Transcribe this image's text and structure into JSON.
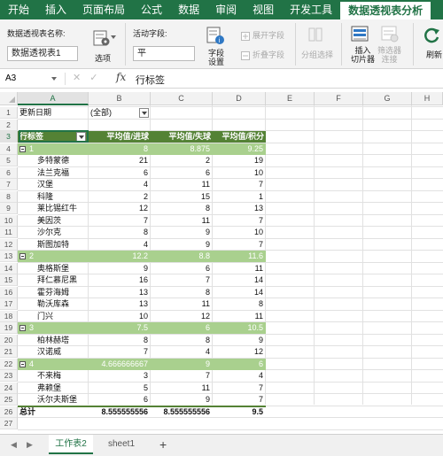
{
  "ribbon_tabs": [
    "开始",
    "插入",
    "页面布局",
    "公式",
    "数据",
    "审阅",
    "视图",
    "开发工具",
    "数据透视表分析"
  ],
  "ribbon": {
    "pt_name_label": "数据透视表名称:",
    "pt_name_value": "数据透视表1",
    "options_label": "选项",
    "active_field_label": "活动字段:",
    "active_field_value": "平",
    "field_settings_label_1": "字段",
    "field_settings_label_2": "设置",
    "expand_field": "展开字段",
    "collapse_field": "折叠字段",
    "group_selection": "分组选择",
    "insert_slicer_1": "插入",
    "insert_slicer_2": "切片器",
    "filter_conn_1": "筛选器",
    "filter_conn_2": "连接",
    "refresh": "刷新"
  },
  "formula_bar": {
    "name_box": "A3",
    "fx_label": "fx",
    "content": "行标签"
  },
  "columns": [
    "A",
    "B",
    "C",
    "D",
    "E",
    "F",
    "G",
    "H"
  ],
  "rows": [
    {
      "n": "1",
      "a": "更新日期",
      "b": "(全部)",
      "c": "",
      "d": "",
      "type": "filter"
    },
    {
      "n": "2",
      "a": "",
      "b": "",
      "c": "",
      "d": "",
      "type": "blank"
    },
    {
      "n": "3",
      "a": "行标签",
      "b": "平均值/进球",
      "c": "平均值/失球",
      "d": "平均值/积分",
      "type": "header"
    },
    {
      "n": "4",
      "a": "1",
      "b": "8",
      "c": "8.875",
      "d": "9.25",
      "type": "group"
    },
    {
      "n": "5",
      "a": "多特蒙德",
      "b": "21",
      "c": "2",
      "d": "19",
      "type": "item"
    },
    {
      "n": "6",
      "a": "法兰克福",
      "b": "6",
      "c": "6",
      "d": "10",
      "type": "item"
    },
    {
      "n": "7",
      "a": "汉堡",
      "b": "4",
      "c": "11",
      "d": "7",
      "type": "item"
    },
    {
      "n": "8",
      "a": "科隆",
      "b": "2",
      "c": "15",
      "d": "1",
      "type": "item"
    },
    {
      "n": "9",
      "a": "莱比锡红牛",
      "b": "12",
      "c": "8",
      "d": "13",
      "type": "item"
    },
    {
      "n": "10",
      "a": "美因茨",
      "b": "7",
      "c": "11",
      "d": "7",
      "type": "item"
    },
    {
      "n": "11",
      "a": "沙尔克",
      "b": "8",
      "c": "9",
      "d": "10",
      "type": "item"
    },
    {
      "n": "12",
      "a": "斯图加特",
      "b": "4",
      "c": "9",
      "d": "7",
      "type": "item"
    },
    {
      "n": "13",
      "a": "2",
      "b": "12.2",
      "c": "8.8",
      "d": "11.6",
      "type": "group"
    },
    {
      "n": "14",
      "a": "奥格斯堡",
      "b": "9",
      "c": "6",
      "d": "11",
      "type": "item"
    },
    {
      "n": "15",
      "a": "拜仁慕尼黑",
      "b": "16",
      "c": "7",
      "d": "14",
      "type": "item"
    },
    {
      "n": "16",
      "a": "霍芬海姆",
      "b": "13",
      "c": "8",
      "d": "14",
      "type": "item"
    },
    {
      "n": "17",
      "a": "勒沃库森",
      "b": "13",
      "c": "11",
      "d": "8",
      "type": "item"
    },
    {
      "n": "18",
      "a": "门兴",
      "b": "10",
      "c": "12",
      "d": "11",
      "type": "item"
    },
    {
      "n": "19",
      "a": "3",
      "b": "7.5",
      "c": "6",
      "d": "10.5",
      "type": "group"
    },
    {
      "n": "20",
      "a": "柏林赫塔",
      "b": "8",
      "c": "8",
      "d": "9",
      "type": "item"
    },
    {
      "n": "21",
      "a": "汉诺威",
      "b": "7",
      "c": "4",
      "d": "12",
      "type": "item"
    },
    {
      "n": "22",
      "a": "4",
      "b": "4.666666667",
      "c": "9",
      "d": "6",
      "type": "group"
    },
    {
      "n": "23",
      "a": "不来梅",
      "b": "3",
      "c": "7",
      "d": "4",
      "type": "item"
    },
    {
      "n": "24",
      "a": "弗赖堡",
      "b": "5",
      "c": "11",
      "d": "7",
      "type": "item"
    },
    {
      "n": "25",
      "a": "沃尔夫斯堡",
      "b": "6",
      "c": "9",
      "d": "7",
      "type": "item"
    },
    {
      "n": "26",
      "a": "总计",
      "b": "8.555555556",
      "c": "8.555555556",
      "d": "9.5",
      "type": "total"
    }
  ],
  "extra_rows": [
    "27"
  ],
  "sheets": {
    "active": "工作表2",
    "other": "sheet1",
    "add": "+"
  },
  "colors": {
    "accent": "#217346",
    "header_band": "#548235",
    "group_band": "#a9d08e"
  }
}
